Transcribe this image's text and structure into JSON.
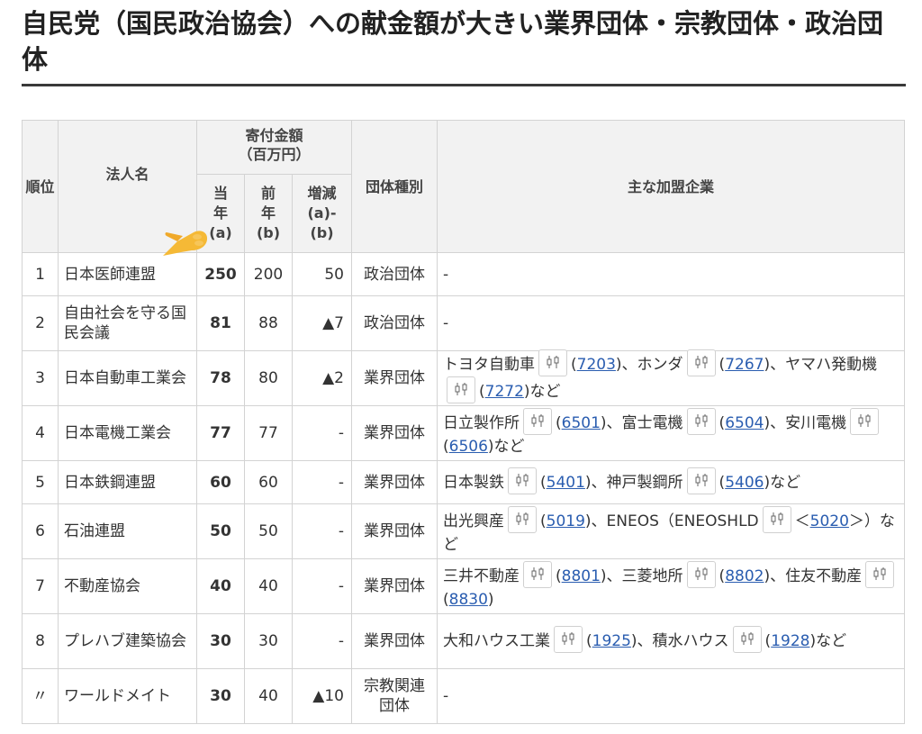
{
  "article": {
    "title": "自民党（国民政治協会）への献金額が大きい業界団体・宗教団体・政治団体"
  },
  "table": {
    "headers": {
      "rank": "順位",
      "name": "法人名",
      "donation_group": "寄付金額（百万円）",
      "current": "当年(a)",
      "previous": "前年(b)",
      "diff": "増減(a)-(b)",
      "type": "団体種別",
      "members": "主な加盟企業"
    },
    "rows": [
      {
        "rank": "1",
        "name": "日本医師連盟",
        "current": "250",
        "previous": "200",
        "diff": "50",
        "type": "政治団体",
        "members": [
          {
            "t": "-"
          }
        ]
      },
      {
        "rank": "2",
        "name": "自由社会を守る国民会議",
        "current": "81",
        "previous": "88",
        "diff": "▲7",
        "type": "政治団体",
        "members": [
          {
            "t": "-"
          }
        ]
      },
      {
        "rank": "3",
        "name": "日本自動車工業会",
        "current": "78",
        "previous": "80",
        "diff": "▲2",
        "type": "業界団体",
        "members": [
          {
            "t": "トヨタ自動車"
          },
          {
            "chip": true
          },
          {
            "t": "("
          },
          {
            "code": "7203"
          },
          {
            "t": ")、ホンダ"
          },
          {
            "chip": true
          },
          {
            "t": "("
          },
          {
            "code": "7267"
          },
          {
            "t": ")、ヤマハ発動機"
          },
          {
            "chip": true
          },
          {
            "t": "("
          },
          {
            "code": "7272"
          },
          {
            "t": ")など"
          }
        ]
      },
      {
        "rank": "4",
        "name": "日本電機工業会",
        "current": "77",
        "previous": "77",
        "diff": "-",
        "type": "業界団体",
        "members": [
          {
            "t": "日立製作所"
          },
          {
            "chip": true
          },
          {
            "t": "("
          },
          {
            "code": "6501"
          },
          {
            "t": ")、富士電機"
          },
          {
            "chip": true
          },
          {
            "t": "("
          },
          {
            "code": "6504"
          },
          {
            "t": ")、安川電機"
          },
          {
            "chip": true
          },
          {
            "t": "("
          },
          {
            "code": "6506"
          },
          {
            "t": ")など"
          }
        ]
      },
      {
        "rank": "5",
        "name": "日本鉄鋼連盟",
        "current": "60",
        "previous": "60",
        "diff": "-",
        "type": "業界団体",
        "members": [
          {
            "t": "日本製鉄"
          },
          {
            "chip": true
          },
          {
            "t": "("
          },
          {
            "code": "5401"
          },
          {
            "t": ")、神戸製鋼所"
          },
          {
            "chip": true
          },
          {
            "t": "("
          },
          {
            "code": "5406"
          },
          {
            "t": ")など"
          }
        ]
      },
      {
        "rank": "6",
        "name": "石油連盟",
        "current": "50",
        "previous": "50",
        "diff": "-",
        "type": "業界団体",
        "members": [
          {
            "t": "出光興産"
          },
          {
            "chip": true
          },
          {
            "t": "("
          },
          {
            "code": "5019"
          },
          {
            "t": ")、ENEOS（ENEOSHLD"
          },
          {
            "chip": true
          },
          {
            "t": "＜"
          },
          {
            "code": "5020"
          },
          {
            "t": "＞）など"
          }
        ]
      },
      {
        "rank": "7",
        "name": "不動産協会",
        "current": "40",
        "previous": "40",
        "diff": "-",
        "type": "業界団体",
        "members": [
          {
            "t": "三井不動産"
          },
          {
            "chip": true
          },
          {
            "t": "("
          },
          {
            "code": "8801"
          },
          {
            "t": ")、三菱地所"
          },
          {
            "chip": true
          },
          {
            "t": "("
          },
          {
            "code": "8802"
          },
          {
            "t": ")、住友不動産"
          },
          {
            "chip": true
          },
          {
            "t": "("
          },
          {
            "code": "8830"
          },
          {
            "t": ")"
          }
        ]
      },
      {
        "rank": "8",
        "name": "プレハブ建築協会",
        "current": "30",
        "previous": "30",
        "diff": "-",
        "type": "業界団体",
        "members": [
          {
            "t": "大和ハウス工業"
          },
          {
            "chip": true
          },
          {
            "t": "("
          },
          {
            "code": "1925"
          },
          {
            "t": ")、積水ハウス"
          },
          {
            "chip": true
          },
          {
            "t": "("
          },
          {
            "code": "1928"
          },
          {
            "t": ")など"
          }
        ]
      },
      {
        "rank": "〃",
        "name": "ワールドメイト",
        "current": "30",
        "previous": "40",
        "diff": "▲10",
        "type": "宗教関連団体",
        "members": [
          {
            "t": "-"
          }
        ]
      }
    ]
  },
  "icons": {
    "chart_chip": "candlestick-chart-icon",
    "pointer": "pointing-hand-emoji-icon"
  },
  "colors": {
    "link": "#2a5db0",
    "header_bg": "#f2f2f2",
    "border": "#d3d3d3",
    "hand": "#f5b936"
  }
}
